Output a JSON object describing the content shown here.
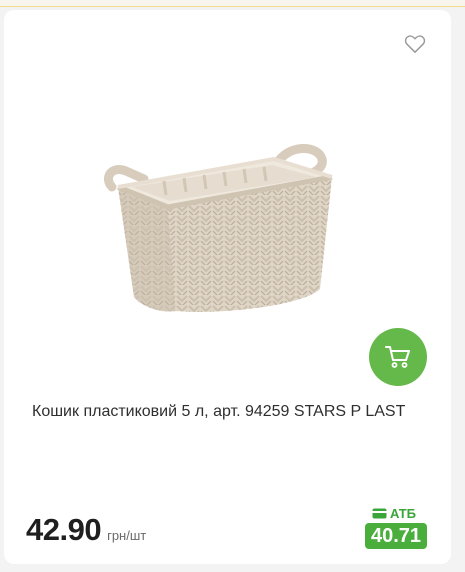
{
  "product": {
    "title": "Кошик пластиковий 5 л, арт. 94259 STARS P LAST",
    "image_icon": "wicker-basket-image",
    "price": "42.90",
    "price_unit": "грн/шт",
    "promo": {
      "label": "АТБ",
      "price": "40.71",
      "icon": "card-icon"
    },
    "favorite_icon": "heart-icon",
    "cart_icon": "cart-icon"
  },
  "colors": {
    "cart_button": "#65b94a",
    "promo_badge": "#4aae3c",
    "promo_label": "#3aa63a",
    "card_background": "#ffffff",
    "page_background": "#f3f3f3"
  }
}
